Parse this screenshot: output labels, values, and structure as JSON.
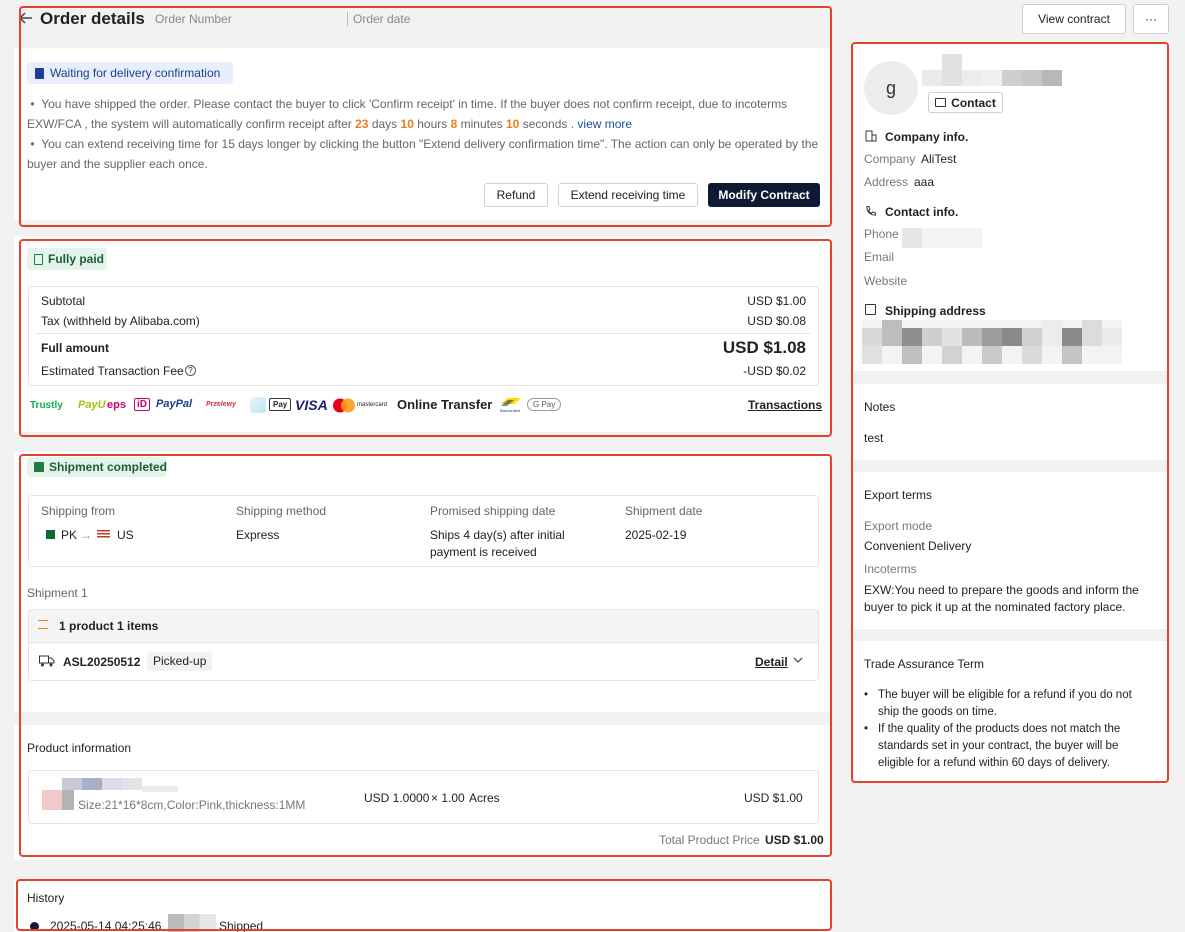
{
  "header": {
    "back_icon": "arrow-left-icon",
    "title": "Order details",
    "order_number_label": "Order Number",
    "order_date_label": "Order date",
    "view_contract": "View contract",
    "more": "···"
  },
  "status": {
    "badge": "Waiting for delivery confirmation",
    "line1_a": "You have shipped the order. Please contact the buyer to click 'Confirm receipt' in time. If the buyer does not confirm receipt, due to incoterms",
    "line1_b": "EXW/FCA , the system will automatically confirm receipt after",
    "days": "23",
    "days_label": "days",
    "hours": "10",
    "hours_label": "hours",
    "minutes": "8",
    "minutes_label": "minutes",
    "seconds": "10",
    "seconds_label": "seconds .",
    "view_more": "view more",
    "line2_a": "You can extend receiving time for 15 days longer by clicking the button \"Extend delivery confirmation time\". The action can only be operated by the",
    "line2_b": "buyer and the supplier each once.",
    "buttons": {
      "refund": "Refund",
      "extend": "Extend receiving time",
      "modify": "Modify Contract"
    }
  },
  "payment": {
    "badge": "Fully paid",
    "subtotal_label": "Subtotal",
    "subtotal": "USD $1.00",
    "tax_label": "Tax (withheld by Alibaba.com)",
    "tax": "USD $0.08",
    "full_label": "Full amount",
    "full": "USD $1.08",
    "fee_label": "Estimated Transaction Fee",
    "fee": "-USD $0.02",
    "methods": {
      "trustly": "Trustly",
      "payu": "PayU",
      "eps": "eps",
      "ideal": "iD",
      "paypal": "PayPal",
      "przelewy": "Przelewy",
      "applepay": "Pay",
      "visa": "VISA",
      "mastercard": "mastercard",
      "online_transfer": "Online Transfer",
      "bancontact": "Bancontact",
      "gpay": "G Pay"
    },
    "transactions_link": "Transactions"
  },
  "shipment": {
    "badge": "Shipment completed",
    "cols": {
      "from": "Shipping from",
      "method": "Shipping method",
      "promised": "Promised shipping date",
      "date": "Shipment date"
    },
    "from_country": "PK",
    "to_country": "US",
    "method": "Express",
    "promised_1": "Ships 4 day(s) after initial",
    "promised_2": "payment is received",
    "date": "2025-02-19",
    "shipment_title": "Shipment 1",
    "products_count": "1 product 1 items",
    "tracking": "ASL20250512",
    "tracking_status": "Picked-up",
    "detail": "Detail"
  },
  "product": {
    "section_title": "Product information",
    "spec": "Size:21*16*8cm,Color:Pink,thickness:1MM",
    "unit_price": "USD 1.0000",
    "qty": "× 1.00",
    "unit": "Acres",
    "line_total": "USD $1.00",
    "total_label": "Total Product Price",
    "total": "USD $1.00"
  },
  "history": {
    "title": "History",
    "entry_time": "2025-05-14 04:25:46",
    "entry_status": "Shipped"
  },
  "buyer": {
    "avatar_letter": "g",
    "contact_btn": "Contact",
    "company_section": "Company info.",
    "company_label": "Company",
    "company_value": "AliTest",
    "address_label": "Address",
    "address_value": "aaa",
    "contact_section": "Contact info.",
    "phone_label": "Phone",
    "email_label": "Email",
    "website_label": "Website",
    "shipping_section": "Shipping address",
    "notes_title": "Notes",
    "notes_value": "test",
    "export_title": "Export terms",
    "export_mode_label": "Export mode",
    "export_mode_value": "Convenient Delivery",
    "incoterms_label": "Incoterms",
    "incoterms_1": "EXW:You need to prepare the goods and inform the",
    "incoterms_2": "buyer to pick it up at the nominated factory place.",
    "trade_title": "Trade Assurance Term",
    "trade_1a": "The buyer will be eligible for a refund if you do not",
    "trade_1b": "ship the goods on time.",
    "trade_2a": "If the quality of the products does not match the",
    "trade_2b": "standards set in your contract, the buyer will be",
    "trade_2c": "eligible for a refund within 60 days of delivery."
  },
  "colors": {
    "accent_red": "#e0442f",
    "dark_button": "#0e1a33",
    "countdown_orange": "#e8801b",
    "link_blue": "#1d4fa8"
  }
}
